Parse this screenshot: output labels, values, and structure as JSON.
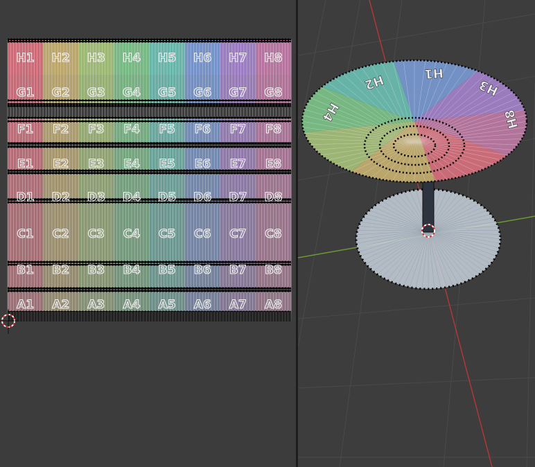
{
  "uv_editor": {
    "grid_rows": [
      {
        "letter": "H",
        "labels": [
          "H1",
          "H2",
          "H3",
          "H4",
          "H5",
          "H6",
          "H7",
          "H8"
        ]
      },
      {
        "letter": "G",
        "labels": [
          "G1",
          "G2",
          "G3",
          "G4",
          "G5",
          "G6",
          "G7",
          "G8"
        ]
      },
      {
        "letter": "F",
        "labels": [
          "F1",
          "F2",
          "F3",
          "F4",
          "F5",
          "F6",
          "F7",
          "F8"
        ]
      },
      {
        "letter": "E",
        "labels": [
          "E1",
          "E2",
          "E3",
          "E4",
          "E5",
          "E6",
          "E7",
          "E8"
        ]
      },
      {
        "letter": "D",
        "labels": [
          "D1",
          "D2",
          "D3",
          "D4",
          "D5",
          "D6",
          "D7",
          "D8"
        ]
      },
      {
        "letter": "C",
        "labels": [
          "C1",
          "C2",
          "C3",
          "C4",
          "C5",
          "C6",
          "C7",
          "C8"
        ]
      },
      {
        "letter": "B",
        "labels": [
          "B1",
          "B2",
          "B3",
          "B4",
          "B5",
          "B6",
          "B7",
          "B8"
        ]
      },
      {
        "letter": "A",
        "labels": [
          "A1",
          "A2",
          "A3",
          "A4",
          "A5",
          "A6",
          "A7",
          "A8"
        ]
      }
    ],
    "column_colors": [
      "#d9707e",
      "#c8b070",
      "#a6c27a",
      "#7cc48a",
      "#6cc0b4",
      "#7a9ad4",
      "#a482cc",
      "#c07aa6"
    ],
    "background_color": "#3c3c3c",
    "cursor_icon": "2d-cursor-icon"
  },
  "viewport": {
    "background_color": "#3d3d3d",
    "x_axis_color": "#b03838",
    "y_axis_color": "#6e9a34",
    "bowl_labels": [
      "H1",
      "H2",
      "H3",
      "H4",
      "H8"
    ],
    "base_color": "#c8d2dc",
    "cursor_icon": "3d-cursor-icon"
  }
}
